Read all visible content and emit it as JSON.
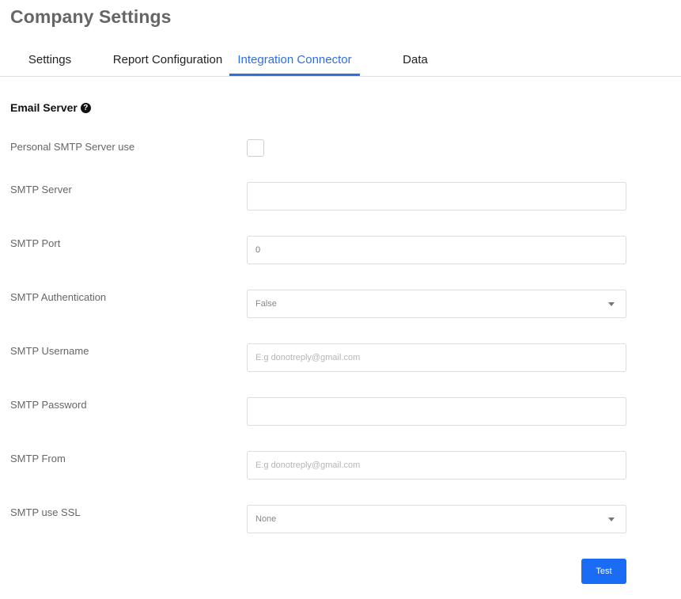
{
  "page": {
    "title": "Company Settings"
  },
  "tabs": [
    {
      "label": "Settings",
      "active": false
    },
    {
      "label": "Report Configuration",
      "active": false
    },
    {
      "label": "Integration Connector",
      "active": true
    },
    {
      "label": "Data",
      "active": false
    }
  ],
  "section": {
    "title": "Email Server",
    "help_icon": "question-circle-icon"
  },
  "form": {
    "personal_smtp": {
      "label": "Personal SMTP Server use",
      "checked": false
    },
    "smtp_server": {
      "label": "SMTP Server",
      "value": "",
      "placeholder": ""
    },
    "smtp_port": {
      "label": "SMTP Port",
      "value": "0"
    },
    "smtp_authentication": {
      "label": "SMTP Authentication",
      "selected": "False"
    },
    "smtp_username": {
      "label": "SMTP Username",
      "value": "",
      "placeholder": "E.g donotreply@gmail.com"
    },
    "smtp_password": {
      "label": "SMTP Password",
      "value": ""
    },
    "smtp_from": {
      "label": "SMTP From",
      "value": "",
      "placeholder": "E.g donotreply@gmail.com"
    },
    "smtp_ssl": {
      "label": "SMTP use SSL",
      "selected": "None"
    }
  },
  "actions": {
    "test_label": "Test"
  },
  "colors": {
    "accent": "#2f6fde",
    "button": "#1a6cf4"
  }
}
